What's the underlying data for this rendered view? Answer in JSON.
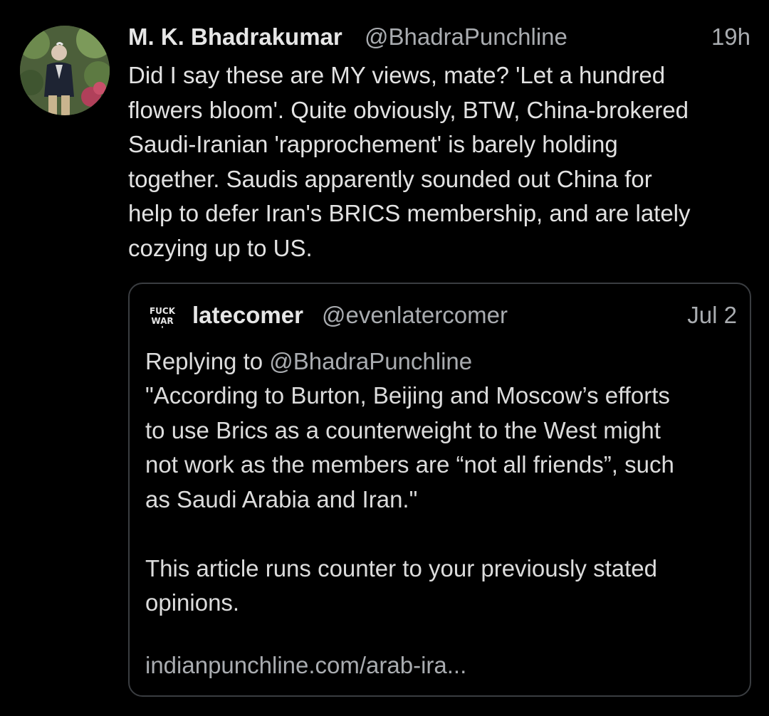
{
  "tweet": {
    "author": {
      "name": "M. K. Bhadrakumar",
      "handle": "@BhadraPunchline"
    },
    "time": "19h",
    "text": "Did I say these are MY views, mate? 'Let a hundred\nflowers bloom'. Quite obviously, BTW, China-brokered\nSaudi-Iranian 'rapprochement' is barely holding\ntogether. Saudis apparently sounded out China for\nhelp to defer Iran's BRICS membership, and are lately\ncozying up to US."
  },
  "quote": {
    "avatar_text": "FUCK WAR",
    "author": {
      "name": "latecomer",
      "handle": "@evenlatercomer"
    },
    "date": "Jul 2",
    "replying_prefix": "Replying to",
    "replying_handle": "@BhadraPunchline",
    "text": "\"According to Burton, Beijing and Moscow’s efforts\nto use Brics as a counterweight to the West might\nnot work as the members are “not all friends”, such\nas Saudi Arabia and Iran.\"\n\nThis article runs counter to your previously stated\nopinions.",
    "link": "indianpunchline.com/arab-ira..."
  },
  "colors": {
    "background": "#000000",
    "primary_text": "#e2e2e2",
    "secondary_text": "#a9acb0",
    "border": "#3a3d41"
  }
}
